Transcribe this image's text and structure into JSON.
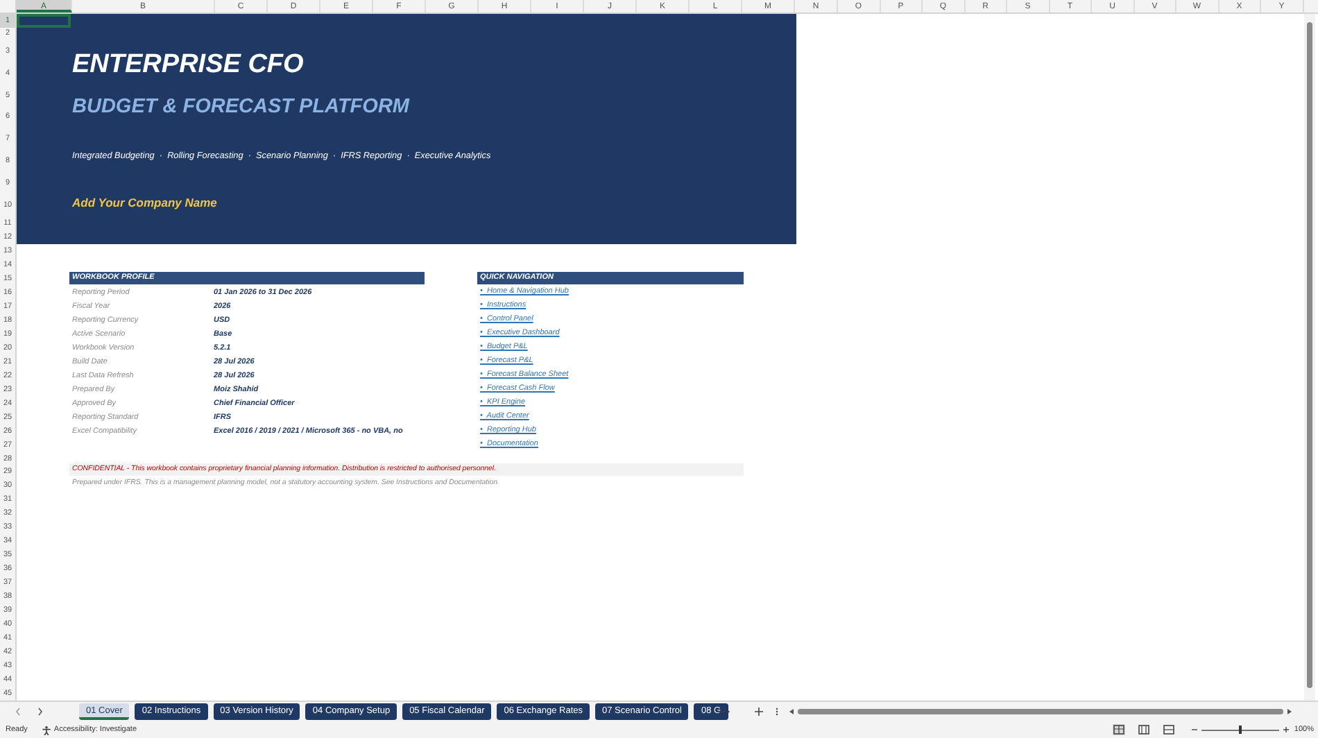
{
  "columns": [
    "A",
    "B",
    "C",
    "D",
    "E",
    "F",
    "G",
    "H",
    "I",
    "J",
    "K",
    "L",
    "M",
    "N",
    "O",
    "P",
    "Q",
    "R",
    "S",
    "T",
    "U",
    "V",
    "W",
    "X",
    "Y"
  ],
  "rows": [
    "1",
    "2",
    "3",
    "4",
    "5",
    "6",
    "7",
    "8",
    "9",
    "10",
    "11",
    "12",
    "13",
    "14",
    "15",
    "16",
    "17",
    "18",
    "19",
    "20",
    "21",
    "22",
    "23",
    "24",
    "25",
    "26",
    "27",
    "28",
    "29",
    "30",
    "31",
    "32",
    "33",
    "34",
    "35",
    "36",
    "37",
    "38",
    "39",
    "40",
    "41",
    "42",
    "43",
    "44",
    "45"
  ],
  "banner": {
    "title": "ENTERPRISE CFO",
    "subtitle": "BUDGET & FORECAST PLATFORM",
    "tagline": "Integrated Budgeting  ·  Rolling Forecasting  ·  Scenario Planning  ·  IFRS Reporting  ·  Executive Analytics",
    "company": "Add Your Company Name"
  },
  "workbook_profile": {
    "heading": "WORKBOOK PROFILE",
    "rows": [
      {
        "label": "Reporting Period",
        "value": "01 Jan 2026  to  31 Dec 2026"
      },
      {
        "label": "Fiscal Year",
        "value": "2026"
      },
      {
        "label": "Reporting Currency",
        "value": "USD"
      },
      {
        "label": "Active Scenario",
        "value": "Base"
      },
      {
        "label": "Workbook Version",
        "value": "5.2.1"
      },
      {
        "label": "Build Date",
        "value": "28 Jul 2026"
      },
      {
        "label": "Last Data Refresh",
        "value": "28 Jul 2026"
      },
      {
        "label": "Prepared By",
        "value": "Moiz Shahid"
      },
      {
        "label": "Approved By",
        "value": "Chief Financial Officer"
      },
      {
        "label": "Reporting Standard",
        "value": "IFRS"
      },
      {
        "label": "Excel Compatibility",
        "value": "Excel 2016 / 2019 / 2021 / Microsoft 365  -  no VBA, no"
      }
    ]
  },
  "quick_navigation": {
    "heading": "QUICK NAVIGATION",
    "links": [
      "•  Home & Navigation Hub",
      "•  Instructions",
      "•  Control Panel",
      "•  Executive Dashboard",
      "•  Budget P&L",
      "•  Forecast P&L",
      "•  Forecast Balance Sheet",
      "•  Forecast Cash Flow",
      "•  KPI Engine",
      "•  Audit Center",
      "•  Reporting Hub",
      "•  Documentation"
    ]
  },
  "confidential": "CONFIDENTIAL - This workbook contains proprietary financial planning information. Distribution is restricted to authorised personnel.",
  "note": "Prepared under IFRS. This is a management planning model, not a statutory accounting system. See Instructions and Documentation.",
  "sheet_tabs": [
    {
      "label": "01 Cover",
      "selected": true
    },
    {
      "label": "02 Instructions",
      "selected": false
    },
    {
      "label": "03 Version History",
      "selected": false
    },
    {
      "label": "04 Company Setup",
      "selected": false
    },
    {
      "label": "05 Fiscal Calendar",
      "selected": false
    },
    {
      "label": "06 Exchange Rates",
      "selected": false
    },
    {
      "label": "07 Scenario Control",
      "selected": false
    },
    {
      "label": "08 G",
      "selected": false
    }
  ],
  "status_bar": {
    "state": "Ready",
    "accessibility": "Accessibility: Investigate",
    "zoom": "100%",
    "zoom_slider": {
      "level": 0.5
    }
  }
}
